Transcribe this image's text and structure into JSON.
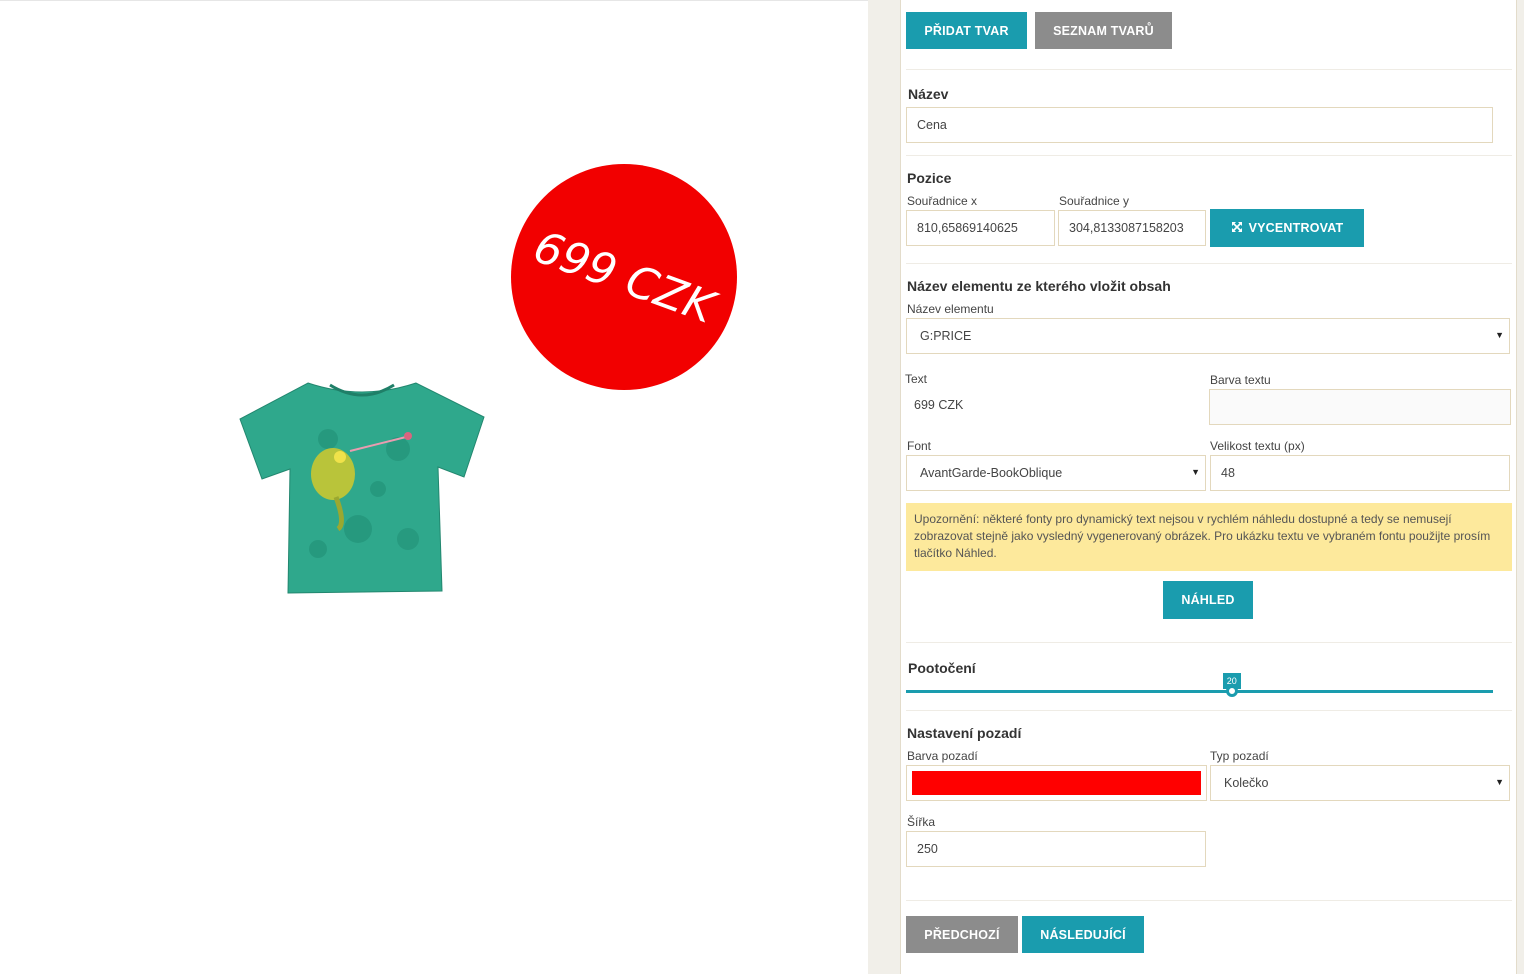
{
  "preview": {
    "badge_text": "699 CZK",
    "badge_color": "#f20000",
    "rotation_deg": 20,
    "product_icon": "tshirt-chameleon-image"
  },
  "toolbar": {
    "add_shape": "PŘIDAT TVAR",
    "shape_list": "SEZNAM TVARŮ"
  },
  "name_section": {
    "title": "Název",
    "value": "Cena"
  },
  "position_section": {
    "title": "Pozice",
    "x_label": "Souřadnice x",
    "x_value": "810,65869140625",
    "y_label": "Souřadnice y",
    "y_value": "304,8133087158203",
    "center_button": "VYCENTROVAT",
    "center_icon": "expand-arrows-icon"
  },
  "element_section": {
    "title": "Název elementu ze kterého vložit obsah",
    "element_label": "Název elementu",
    "element_value": "G:PRICE"
  },
  "text_section": {
    "text_label": "Text",
    "text_value": "699 CZK",
    "color_label": "Barva textu",
    "color_value": "",
    "font_label": "Font",
    "font_value": "AvantGarde-BookOblique",
    "size_label": "Velikost textu (px)",
    "size_value": "48"
  },
  "notice": {
    "text": "Upozornění: některé fonty pro dynamický text nejsou v rychlém náhledu dostupné a tedy se nemusejí zobrazovat stejně jako vysledný vygenerovaný obrázek. Pro ukázku textu ve vybraném fontu použijte prosím tlačítko Náhled."
  },
  "preview_button": "NÁHLED",
  "rotation_section": {
    "title": "Pootočení",
    "value": "20",
    "fraction": 0.555
  },
  "background_section": {
    "title": "Nastavení pozadí",
    "color_label": "Barva pozadí",
    "color_value": "#ff0000",
    "type_label": "Typ pozadí",
    "type_value": "Kolečko",
    "width_label": "Šířka",
    "width_value": "250"
  },
  "nav": {
    "prev": "PŘEDCHOZÍ",
    "next": "NÁSLEDUJÍCÍ"
  }
}
